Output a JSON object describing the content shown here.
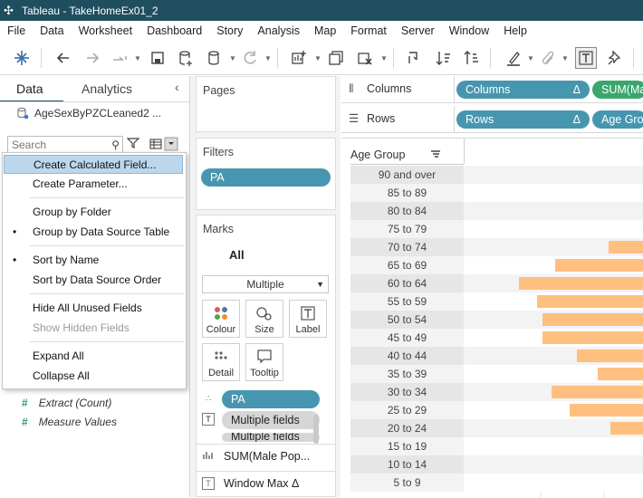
{
  "window": {
    "title": "Tableau - TakeHomeEx01_2"
  },
  "menu": [
    "File",
    "Data",
    "Worksheet",
    "Dashboard",
    "Story",
    "Analysis",
    "Map",
    "Format",
    "Server",
    "Window",
    "Help"
  ],
  "left_pane": {
    "tabs": {
      "data": "Data",
      "analytics": "Analytics"
    },
    "datasource": "AgeSexByPZCLeaned2 ...",
    "search_placeholder": "Search",
    "menu_items": [
      {
        "label": "Create Calculated Field...",
        "highlighted": true
      },
      {
        "label": "Create Parameter..."
      },
      {
        "label": "Group by Folder"
      },
      {
        "label": "Group by Data Source Table",
        "checked": true
      },
      {
        "label": "Sort by Name",
        "checked": true
      },
      {
        "label": "Sort by Data Source Order"
      },
      {
        "label": "Hide All Unused Fields"
      },
      {
        "label": "Show Hidden Fields",
        "disabled": true
      },
      {
        "label": "Expand All"
      },
      {
        "label": "Collapse All"
      }
    ],
    "fields": [
      "Extract (Count)",
      "Measure Values"
    ]
  },
  "cards": {
    "pages_title": "Pages",
    "filters_title": "Filters",
    "filter_pill": "PA",
    "marks_title": "Marks",
    "marks_all": "All",
    "mark_type": "Multiple",
    "mark_buttons": [
      "Colour",
      "Size",
      "Label",
      "Detail",
      "Tooltip"
    ],
    "mark_pills": [
      "PA",
      "Multiple fields",
      "Multiple fields"
    ],
    "sum_row": "SUM(Male Pop...",
    "window_row": "Window Max Δ"
  },
  "shelves": {
    "columns_label": "Columns",
    "rows_label": "Rows",
    "columns_pills": [
      {
        "label": "Columns",
        "delta": "Δ"
      },
      {
        "label": "SUM(Ma"
      }
    ],
    "rows_pills": [
      {
        "label": "Rows",
        "delta": "Δ"
      },
      {
        "label": "Age Gro"
      }
    ]
  },
  "view": {
    "header": "Age Group",
    "colors": {
      "bar": "#ffbf7f",
      "pill_blue": "#4796b0",
      "pill_green": "#3aa66b",
      "titlebar": "#1f4e5f"
    },
    "rows": [
      {
        "label": "90 and over",
        "value": 0
      },
      {
        "label": "85 to 89",
        "value": 0
      },
      {
        "label": "80 to 84",
        "value": 0
      },
      {
        "label": "75 to 79",
        "value": 0
      },
      {
        "label": "70 to 74",
        "value": 0.19
      },
      {
        "label": "65 to 69",
        "value": 0.49
      },
      {
        "label": "60 to 64",
        "value": 0.69
      },
      {
        "label": "55 to 59",
        "value": 0.59
      },
      {
        "label": "50 to 54",
        "value": 0.56
      },
      {
        "label": "45 to 49",
        "value": 0.56
      },
      {
        "label": "40 to 44",
        "value": 0.37
      },
      {
        "label": "35 to 39",
        "value": 0.25
      },
      {
        "label": "30 to 34",
        "value": 0.51
      },
      {
        "label": "25 to 29",
        "value": 0.41
      },
      {
        "label": "20 to 24",
        "value": 0.18
      },
      {
        "label": "15 to 19",
        "value": 0
      },
      {
        "label": "10 to 14",
        "value": 0
      },
      {
        "label": "5 to 9",
        "value": 0
      }
    ]
  }
}
